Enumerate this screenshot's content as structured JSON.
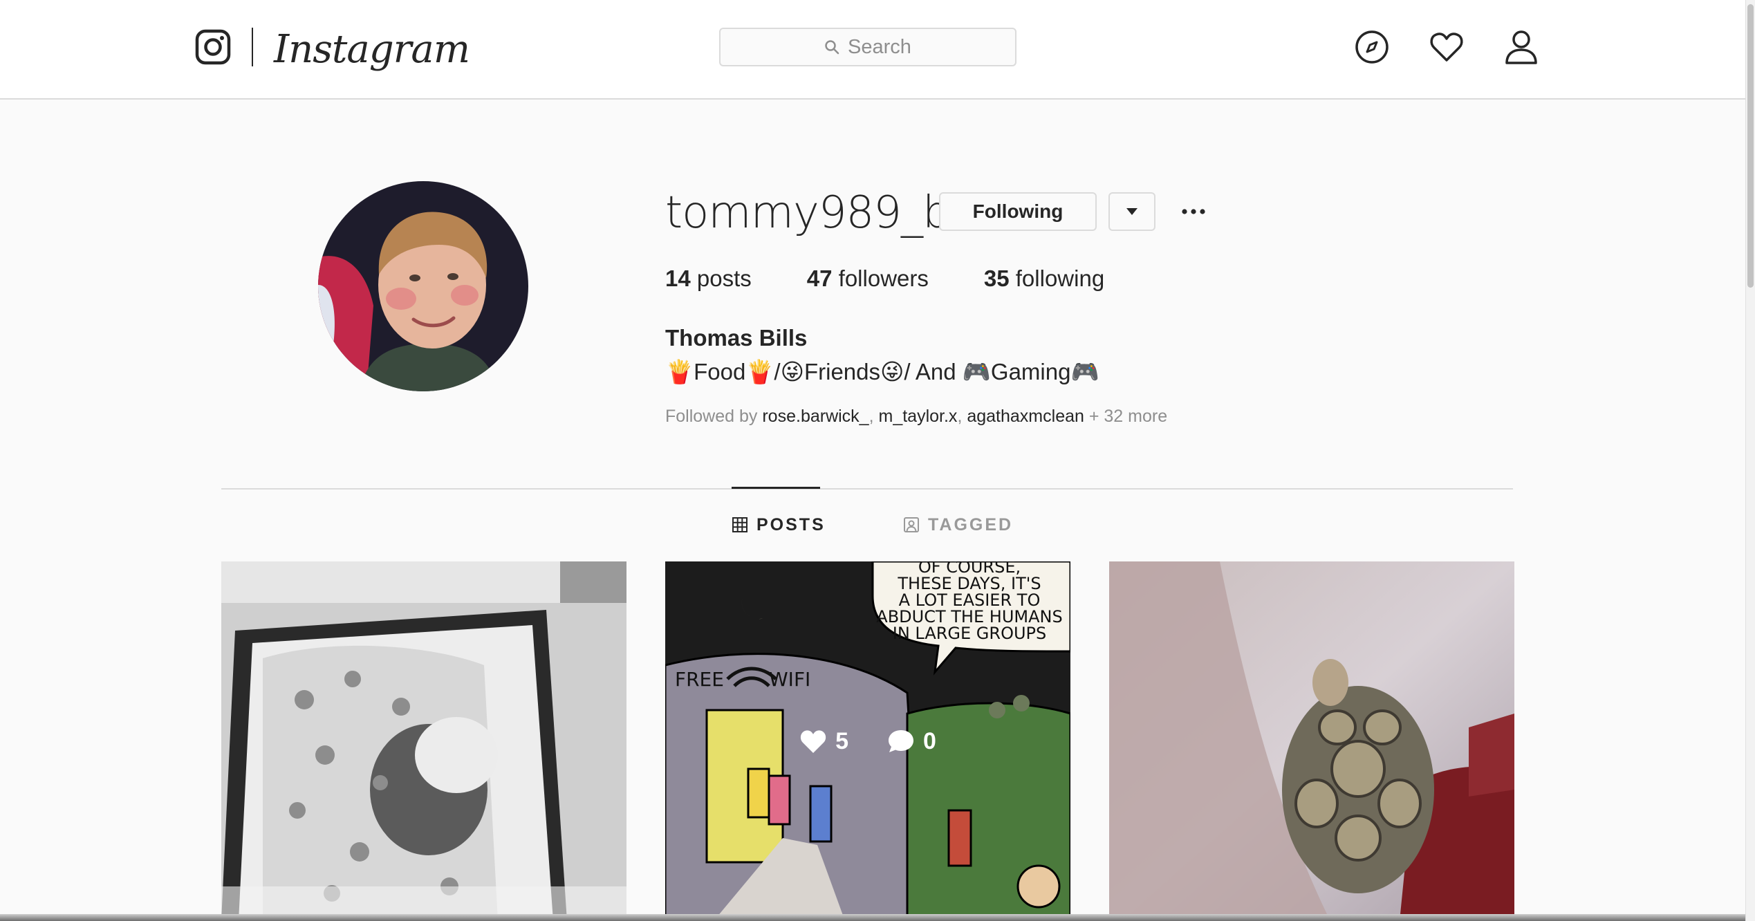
{
  "nav": {
    "wordmark": "Instagram",
    "search_placeholder": "Search",
    "icons": [
      "instagram-camera-icon",
      "compass-icon",
      "heart-icon",
      "user-icon",
      "search-icon"
    ]
  },
  "profile": {
    "username": "tommy989_b",
    "following_button": "Following",
    "stats": {
      "posts_count": "14",
      "posts_label": "posts",
      "followers_count": "47",
      "followers_label": "followers",
      "following_count": "35",
      "following_label": "following"
    },
    "full_name": "Thomas Bills",
    "bio": "🍟Food🍟/😜Friends😜/ And 🎮Gaming🎮",
    "followed_by": {
      "prefix": "Followed by",
      "names": [
        "rose.barwick_",
        "m_taylor.x",
        "agathaxmclean"
      ],
      "suffix": "+ 32 more"
    }
  },
  "tabs": [
    {
      "label": "POSTS",
      "active": true
    },
    {
      "label": "TAGGED",
      "active": false
    }
  ],
  "posts": [
    {
      "kind": "photo-portrait-bw"
    },
    {
      "kind": "comic",
      "likes": "5",
      "comments": "0",
      "comic_text": {
        "speech": [
          "OF COURSE,",
          "THESE DAYS, IT'S",
          "A LOT EASIER TO",
          "ABDUCT THE HUMANS",
          "IN LARGE GROUPS"
        ],
        "sign_left": "FREE",
        "sign_right": "WIFI"
      }
    },
    {
      "kind": "photo-tortoise"
    }
  ],
  "colors": {
    "background": "#fafafa",
    "border": "#dbdbdb",
    "text": "#262626",
    "muted": "#8e8e8e"
  }
}
